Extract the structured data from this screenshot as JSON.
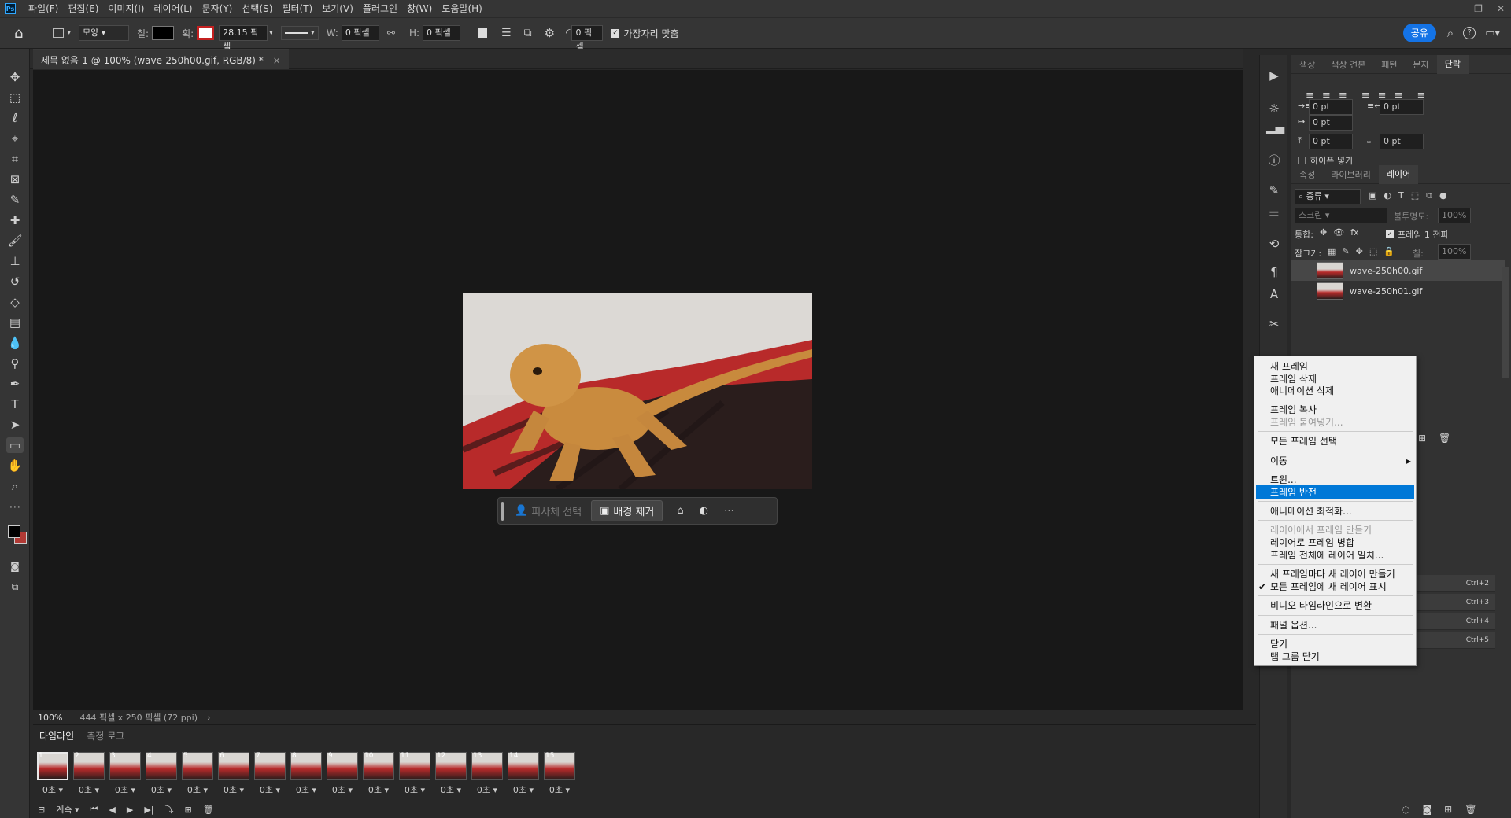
{
  "app": {
    "logo": "Ps"
  },
  "menubar": {
    "items": [
      "파일(F)",
      "편집(E)",
      "이미지(I)",
      "레이어(L)",
      "문자(Y)",
      "선택(S)",
      "필터(T)",
      "보기(V)",
      "플러그인",
      "창(W)",
      "도움말(H)"
    ],
    "min": "—",
    "restore": "❐",
    "close": "✕"
  },
  "options": {
    "shape_mode": "모양",
    "fill_label": "칠:",
    "stroke_label": "획:",
    "stroke_width": "28.15 픽셀",
    "w_label": "W:",
    "w_value": "0 픽셀",
    "h_label": "H:",
    "h_value": "0 픽셀",
    "radius_value": "0 픽셀",
    "align_edges": "가장자리 맞춤",
    "share": "공유"
  },
  "document": {
    "tab_title": "제목 없음-1 @ 100% (wave-250h00.gif, RGB/8) *",
    "tab_close": "×"
  },
  "context_bar": {
    "select_subject": "피사체 선택",
    "remove_bg": "배경 제거",
    "more": "⋯"
  },
  "status": {
    "zoom": "100%",
    "info": "444 픽셀 x 250 픽셀 (72 ppi)",
    "arrow": "›"
  },
  "timeline": {
    "tabs": [
      "타임라인",
      "측정 로그"
    ],
    "frames": [
      {
        "n": "1",
        "delay": "0초"
      },
      {
        "n": "2",
        "delay": "0초"
      },
      {
        "n": "3",
        "delay": "0초"
      },
      {
        "n": "4",
        "delay": "0초"
      },
      {
        "n": "5",
        "delay": "0초"
      },
      {
        "n": "6",
        "delay": "0초"
      },
      {
        "n": "7",
        "delay": "0초"
      },
      {
        "n": "8",
        "delay": "0초"
      },
      {
        "n": "9",
        "delay": "0초"
      },
      {
        "n": "10",
        "delay": "0초"
      },
      {
        "n": "11",
        "delay": "0초"
      },
      {
        "n": "12",
        "delay": "0초"
      },
      {
        "n": "13",
        "delay": "0초"
      },
      {
        "n": "14",
        "delay": "0초"
      },
      {
        "n": "15",
        "delay": "0초"
      }
    ],
    "loop": "계속"
  },
  "panels": {
    "top_tabs": [
      "색상",
      "색상 견본",
      "패턴",
      "문자",
      "단락"
    ],
    "paragraph_fields": [
      "0 pt",
      "0 pt",
      "0 pt",
      "0 pt",
      "0 pt"
    ],
    "hyphenate": "하이픈 넣기",
    "mid_tabs": [
      "속성",
      "라이브러리",
      "레이어"
    ],
    "filter_kind": "종류",
    "blend_mode": "스크린",
    "opacity_label": "불투명도:",
    "opacity": "100%",
    "unify_label": "통합:",
    "propagate": "프레임 1 전파",
    "lock_label": "잠그기:",
    "fill_label": "칠:",
    "fill": "100%",
    "layers": [
      "wave-250h00.gif",
      "wave-250h01.gif"
    ]
  },
  "shortcuts": [
    "Ctrl+2",
    "Ctrl+3",
    "Ctrl+4",
    "Ctrl+5"
  ],
  "context_menu": {
    "items": [
      {
        "label": "새 프레임",
        "state": "normal"
      },
      {
        "label": "프레임 삭제",
        "state": "normal"
      },
      {
        "label": "애니메이션 삭제",
        "state": "normal"
      },
      {
        "label": "프레임 복사",
        "state": "normal"
      },
      {
        "label": "프레임 붙여넣기...",
        "state": "disabled"
      },
      {
        "label": "모든 프레임 선택",
        "state": "normal"
      },
      {
        "label": "이동",
        "state": "submenu"
      },
      {
        "label": "트윈...",
        "state": "normal"
      },
      {
        "label": "프레임 반전",
        "state": "highlighted"
      },
      {
        "label": "애니메이션 최적화...",
        "state": "normal"
      },
      {
        "label": "레이어에서 프레임 만들기",
        "state": "disabled"
      },
      {
        "label": "레이어로 프레임 병합",
        "state": "normal"
      },
      {
        "label": "프레임 전체에 레이어 일치...",
        "state": "normal"
      },
      {
        "label": "새 프레임마다 새 레이어 만들기",
        "state": "normal"
      },
      {
        "label": "모든 프레임에 새 레이어 표시",
        "state": "checked"
      },
      {
        "label": "비디오 타임라인으로 변환",
        "state": "normal"
      },
      {
        "label": "패널 옵션...",
        "state": "normal"
      },
      {
        "label": "닫기",
        "state": "normal"
      },
      {
        "label": "탭 그룹 닫기",
        "state": "normal"
      }
    ]
  },
  "colors": {
    "accent": "#1473e6",
    "menu_highlight": "#0078d7",
    "canvas_bg": "#181818",
    "panel_bg": "#323232"
  }
}
